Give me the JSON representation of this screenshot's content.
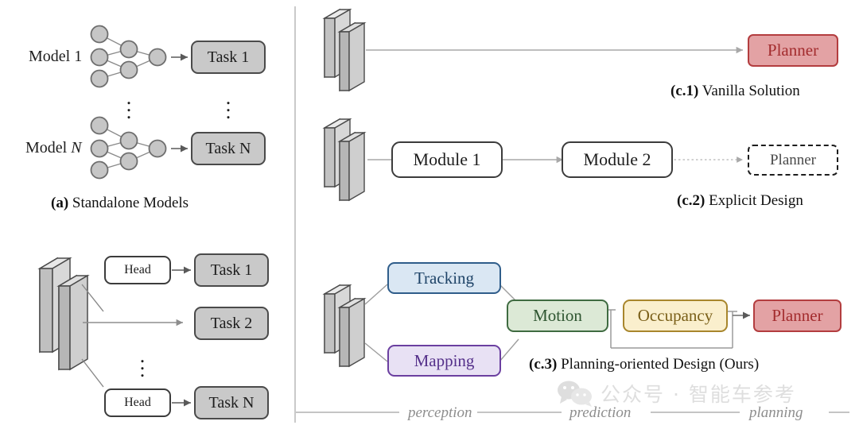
{
  "figure": {
    "panel_a": {
      "caption_prefix": "(a)",
      "caption_text": "Standalone Models",
      "rows": [
        {
          "model_label": "Model 1",
          "model_index": "1",
          "task_label": "Task 1"
        },
        {
          "model_label": "Model N",
          "model_index": "N",
          "task_label": "Task N"
        }
      ],
      "ellipsis": "⋮"
    },
    "panel_b": {
      "head_label": "Head",
      "tasks": [
        "Task 1",
        "Task 2",
        "Task N"
      ],
      "ellipsis": "⋮"
    },
    "panel_c1": {
      "caption_prefix": "(c.1)",
      "caption_text": "Vanilla Solution",
      "planner_label": "Planner"
    },
    "panel_c2": {
      "caption_prefix": "(c.2)",
      "caption_text": "Explicit Design",
      "module1_label": "Module 1",
      "module2_label": "Module 2",
      "planner_label": "Planner"
    },
    "panel_c3": {
      "caption_prefix": "(c.3)",
      "caption_text": "Planning-oriented Design (Ours)",
      "tracking_label": "Tracking",
      "mapping_label": "Mapping",
      "motion_label": "Motion",
      "occupancy_label": "Occupancy",
      "planner_label": "Planner"
    },
    "stages": [
      "perception",
      "prediction",
      "planning"
    ],
    "watermark": {
      "text": "公众号 · 智能车参考"
    },
    "colors": {
      "task_fill": "#c9c9c9",
      "task_border": "#4a4a4a",
      "tracking_fill": "#dae7f3",
      "tracking_border": "#2f5d8a",
      "mapping_fill": "#e8e1f4",
      "mapping_border": "#6b3fa0",
      "motion_fill": "#dce9d6",
      "motion_border": "#3f6b41",
      "occupancy_fill": "#faefcd",
      "occupancy_border": "#a8862c",
      "planner_fill": "#e3a2a4",
      "planner_border": "#b33d3f",
      "connector": "#9a9a9a",
      "divider": "#b9b9b9"
    }
  }
}
